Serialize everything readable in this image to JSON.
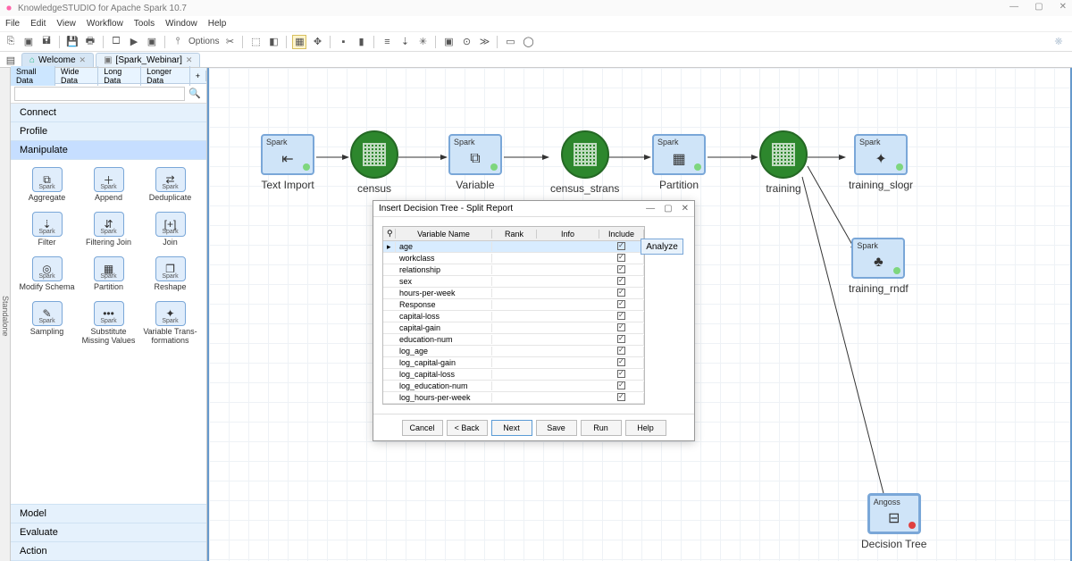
{
  "titlebar": {
    "text": "KnowledgeSTUDIO for Apache Spark 10.7"
  },
  "window_controls": {
    "min": "—",
    "max": "▢",
    "close": "✕"
  },
  "menu": [
    "File",
    "Edit",
    "View",
    "Workflow",
    "Tools",
    "Window",
    "Help"
  ],
  "toolbar_options_label": "Options",
  "tabs": [
    {
      "label": "Welcome",
      "closable": true
    },
    {
      "label": "[Spark_Webinar]",
      "closable": true,
      "active": true
    }
  ],
  "sidebar_strip": "Standalone",
  "data_tabs": {
    "items": [
      "Small Data",
      "Wide Data",
      "Long Data",
      "Longer Data"
    ],
    "active": 0,
    "plus": "+"
  },
  "search": {
    "placeholder": "",
    "icon": "🔍"
  },
  "accordion": {
    "headers": [
      "Connect",
      "Profile",
      "Manipulate",
      "Model",
      "Evaluate",
      "Action"
    ],
    "active": 2
  },
  "tools_badge": "Spark",
  "tools": [
    {
      "label": "Aggregate",
      "glyph": "⧉"
    },
    {
      "label": "Append",
      "glyph": "＋"
    },
    {
      "label": "Deduplicate",
      "glyph": "⇄"
    },
    {
      "label": "Filter",
      "glyph": "⇣"
    },
    {
      "label": "Filtering Join",
      "glyph": "⇵"
    },
    {
      "label": "Join",
      "glyph": "[+]"
    },
    {
      "label": "Modify Schema",
      "glyph": "◎"
    },
    {
      "label": "Partition",
      "glyph": "▦"
    },
    {
      "label": "Reshape",
      "glyph": "❐"
    },
    {
      "label": "Sampling",
      "glyph": "✎"
    },
    {
      "label": "Substitute Missing Values",
      "glyph": "•••"
    },
    {
      "label": "Variable Trans- formations",
      "glyph": "✦"
    }
  ],
  "nodes": {
    "text_import": {
      "label": "Text Import",
      "tag": "Spark",
      "status": "green"
    },
    "census": {
      "label": "census"
    },
    "variable": {
      "label": "Variable",
      "tag": "Spark",
      "status": "green"
    },
    "census_strans": {
      "label": "census_strans"
    },
    "partition": {
      "label": "Partition",
      "tag": "Spark",
      "status": "green"
    },
    "training": {
      "label": "training"
    },
    "training_slogr": {
      "label": "training_slogr",
      "tag": "Spark",
      "status": "green"
    },
    "training_rndf": {
      "label": "training_rndf",
      "tag": "Spark",
      "status": "green"
    },
    "decision_tree": {
      "label": "Decision Tree",
      "tag": "Angoss",
      "status": "red"
    }
  },
  "dialog": {
    "title": "Insert Decision Tree - Split Report",
    "columns": {
      "var": "Variable Name",
      "rank": "Rank",
      "info": "Info",
      "include": "Include"
    },
    "rows": [
      {
        "name": "age",
        "sel": true
      },
      {
        "name": "workclass"
      },
      {
        "name": "relationship"
      },
      {
        "name": "sex"
      },
      {
        "name": "hours-per-week"
      },
      {
        "name": "Response"
      },
      {
        "name": "capital-loss"
      },
      {
        "name": "capital-gain"
      },
      {
        "name": "education-num"
      },
      {
        "name": "log_age"
      },
      {
        "name": "log_capital-gain"
      },
      {
        "name": "log_capital-loss"
      },
      {
        "name": "log_education-num"
      },
      {
        "name": "log_hours-per-week"
      }
    ],
    "analyze_label": "Analyze",
    "buttons": {
      "cancel": "Cancel",
      "back": "< Back",
      "next": "Next",
      "save": "Save",
      "run": "Run",
      "help": "Help"
    }
  }
}
